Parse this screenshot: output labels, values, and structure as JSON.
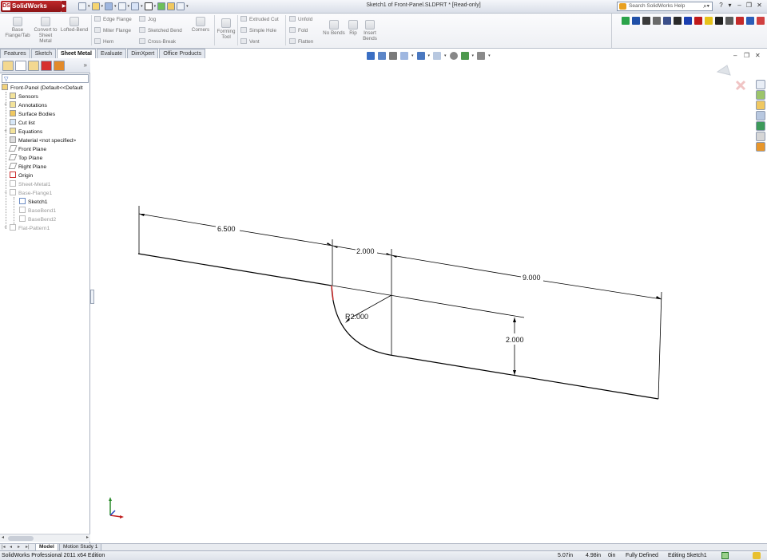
{
  "app": {
    "logo_text": "SolidWorks",
    "window_title": "Sketch1 of Front-Panel.SLDPRT * [Read-only]"
  },
  "help": {
    "placeholder": "Search SolidWorks Help"
  },
  "ribbon": {
    "base_flange": "Base Flange/Tab",
    "convert": "Convert to Sheet Metal",
    "lofted_bend": "Lofted-Bend",
    "edge_flange": "Edge Flange",
    "miter_flange": "Miter Flange",
    "hem": "Hem",
    "jog": "Jog",
    "sketched_bend": "Sketched Bend",
    "cross_break": "Cross-Break",
    "corners": "Corners",
    "forming_tool": "Forming Tool",
    "extruded_cut": "Extruded Cut",
    "simple_hole": "Simple Hole",
    "vent": "Vent",
    "unfold": "Unfold",
    "fold": "Fold",
    "flatten": "Flatten",
    "no_bends": "No Bends",
    "rip": "Rip",
    "insert_bends": "Insert Bends"
  },
  "tabs": [
    "Features",
    "Sketch",
    "Sheet Metal",
    "Evaluate",
    "DimXpert",
    "Office Products"
  ],
  "tree": {
    "root": "Front-Panel  (Default<<Default",
    "items": [
      "Sensors",
      "Annotations",
      "Surface Bodies",
      "Cut list",
      "Equations",
      "Material <not specified>",
      "Front Plane",
      "Top Plane",
      "Right Plane",
      "Origin",
      "Sheet-Metal1",
      "Base-Flange1",
      "Sketch1",
      "BaseBend1",
      "BaseBend2",
      "Flat-Pattern1"
    ]
  },
  "dimensions": {
    "d1": "6.500",
    "d2": "2.000",
    "d3": "9.000",
    "radius": "R2.000",
    "height": "2.000"
  },
  "bottom_tabs": [
    "Model",
    "Motion Study 1"
  ],
  "status": {
    "edition": "SolidWorks Professional 2011 x64 Edition",
    "x": "5.07in",
    "y": "4.98in",
    "z": "0in",
    "state": "Fully Defined",
    "mode": "Editing Sketch1"
  }
}
